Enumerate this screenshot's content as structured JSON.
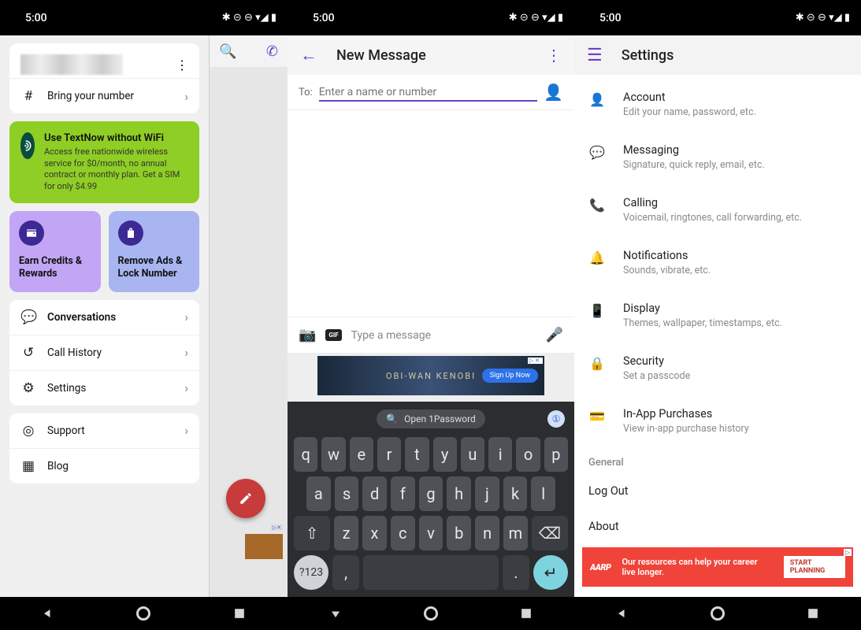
{
  "statusbar": {
    "time": "5:00",
    "icons": "✱ ⊝ ⊖ ▾◢ ▮"
  },
  "phone1": {
    "bring_number": "Bring your number",
    "promo_title": "Use TextNow without WiFi",
    "promo_desc": "Access free nationwide wireless service for $0/month, no annual contract or monthly plan. Get a SIM for only $4.99",
    "card_credits": "Earn Credits & Rewards",
    "card_noads": "Remove Ads & Lock Number",
    "nav_conversations": "Conversations",
    "nav_history": "Call History",
    "nav_settings": "Settings",
    "nav_support": "Support",
    "nav_blog": "Blog",
    "search_hint": "Search"
  },
  "phone2": {
    "title": "New Message",
    "to_label": "To:",
    "to_placeholder": "Enter a name or number",
    "compose_placeholder": "Type a message",
    "ad_text": "OBI-WAN KENOBI",
    "ad_cta": "Sign Up Now",
    "suggest": "Open 1Password",
    "row1": [
      "q",
      "w",
      "e",
      "r",
      "t",
      "y",
      "u",
      "i",
      "o",
      "p"
    ],
    "row2": [
      "a",
      "s",
      "d",
      "f",
      "g",
      "h",
      "j",
      "k",
      "l"
    ],
    "row3": [
      "z",
      "x",
      "c",
      "v",
      "b",
      "n",
      "m"
    ],
    "symkey": "?123"
  },
  "phone3": {
    "title": "Settings",
    "items": [
      {
        "title": "Account",
        "sub": "Edit your name, password, etc."
      },
      {
        "title": "Messaging",
        "sub": "Signature, quick reply, email, etc."
      },
      {
        "title": "Calling",
        "sub": "Voicemail, ringtones, call forwarding, etc."
      },
      {
        "title": "Notifications",
        "sub": "Sounds, vibrate, etc."
      },
      {
        "title": "Display",
        "sub": "Themes, wallpaper, timestamps, etc."
      },
      {
        "title": "Security",
        "sub": "Set a passcode"
      },
      {
        "title": "In-App Purchases",
        "sub": "View in-app purchase history"
      }
    ],
    "section_general": "General",
    "logout": "Log Out",
    "about": "About",
    "ad_brand": "AARP",
    "ad_msg": "Our resources can help your career live longer.",
    "ad_cta": "START PLANNING"
  }
}
